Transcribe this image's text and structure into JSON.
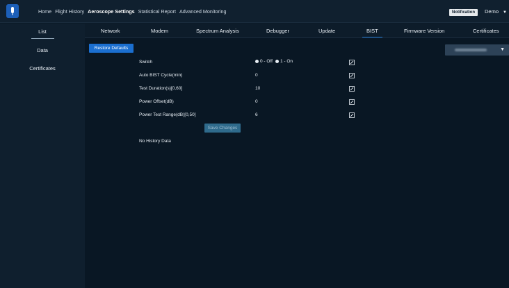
{
  "header": {
    "nav": [
      "Home",
      "Flight History",
      "Aeroscope Settings",
      "Statistical Report",
      "Advanced Monitoring"
    ],
    "active_nav": "Aeroscope Settings",
    "notification": "Notification",
    "user": "Demo"
  },
  "sidebar": {
    "items": [
      {
        "label": "List"
      },
      {
        "label": "Data"
      },
      {
        "label": "Certificates"
      }
    ]
  },
  "tabs": [
    "Network",
    "Modem",
    "Spectrum Analysis",
    "Debugger",
    "Update",
    "BIST",
    "Firmware Version",
    "Certificates"
  ],
  "active_tab": "BIST",
  "main": {
    "restore_label": "Restore Defaults",
    "switch_label": "Switch",
    "switch_options": [
      "0 - Off",
      "1 - On"
    ],
    "fields": [
      {
        "label": "Auto BIST Cycle(min)",
        "value": "0"
      },
      {
        "label": "Test Duration(s)[0,60]",
        "value": "10"
      },
      {
        "label": "Power Offset(dB)",
        "value": "0"
      },
      {
        "label": "Power Test Range(dB)[0,50]",
        "value": "6"
      }
    ],
    "save_label": "Save Changes",
    "history": "No History Data"
  },
  "icons": {
    "edit": "edit-icon",
    "logo": "aeroscope-logo-icon",
    "caret": "chevron-down-icon"
  },
  "colors": {
    "accent": "#1b6fd0",
    "background": "#091724"
  }
}
